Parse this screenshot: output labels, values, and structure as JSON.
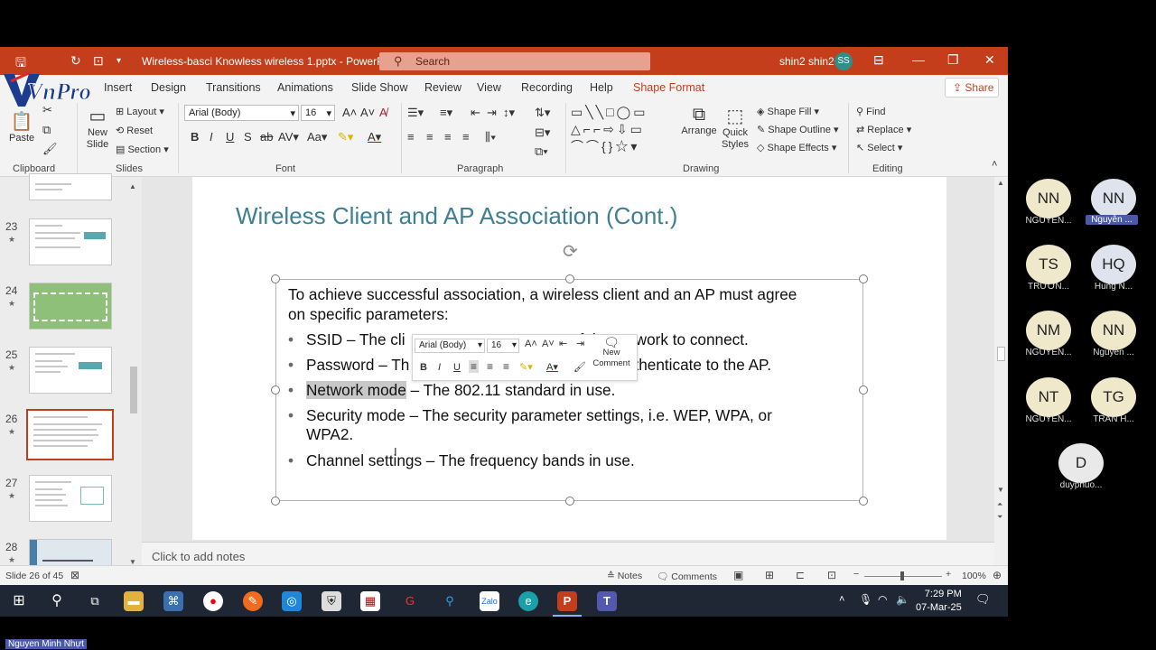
{
  "window": {
    "doc_title": "Wireless-basci Knowless wireless 1.pptx  -  PowerPoint",
    "search_placeholder": "Search",
    "user_name": "shin2 shin2",
    "user_initials": "SS"
  },
  "logo": {
    "text": "VnPro"
  },
  "ribbon_tabs": [
    "Insert",
    "Design",
    "Transitions",
    "Animations",
    "Slide Show",
    "Review",
    "View",
    "Recording",
    "Help",
    "Shape Format"
  ],
  "share_label": "Share",
  "ribbon": {
    "clipboard": {
      "paste": "Paste",
      "group": "Clipboard"
    },
    "slides": {
      "new_slide": "New Slide",
      "layout": "Layout",
      "reset": "Reset",
      "section": "Section",
      "group": "Slides"
    },
    "font": {
      "name": "Arial (Body)",
      "size": "16",
      "group": "Font"
    },
    "paragraph": {
      "group": "Paragraph"
    },
    "drawing": {
      "arrange": "Arrange",
      "quick_styles": "Quick Styles",
      "shape_fill": "Shape Fill",
      "shape_outline": "Shape Outline",
      "shape_effects": "Shape Effects",
      "group": "Drawing"
    },
    "editing": {
      "find": "Find",
      "replace": "Replace",
      "select": "Select",
      "group": "Editing"
    }
  },
  "thumbnails": [
    {
      "num": "23"
    },
    {
      "num": "24"
    },
    {
      "num": "25"
    },
    {
      "num": "26",
      "selected": true
    },
    {
      "num": "27"
    },
    {
      "num": "28"
    }
  ],
  "slide": {
    "title": "Wireless Client and AP Association (Cont.)",
    "intro_line1": "To achieve successful association, a wireless client and an AP must agree",
    "intro_line2": "on specific parameters:",
    "bullets": {
      "b1_start": "SSID – The cli",
      "b1_end": "f the network to connect.",
      "b2_start": "Password – Th",
      "b2_end": "authenticate to the AP.",
      "b3_highlight": "Network mode",
      "b3_rest": " – The 802.11 standard in use.",
      "b4_line1": "Security mode – The security parameter settings, i.e. WEP, WPA, or",
      "b4_line2": "WPA2.",
      "b5": "Channel settings – The frequency bands in use."
    }
  },
  "mini_toolbar": {
    "font": "Arial (Body)",
    "size": "16",
    "new_comment": "New Comment"
  },
  "notes_placeholder": "Click to add notes",
  "status": {
    "slide": "Slide 26 of 45",
    "notes": "Notes",
    "comments": "Comments",
    "zoom": "100%"
  },
  "clock": {
    "time": "7:29 PM",
    "date": "07-Mar-25"
  },
  "participants": [
    {
      "initials": "NN",
      "name": "NGUYEN..."
    },
    {
      "initials": "NN",
      "name": "Nguyễn ..."
    },
    {
      "initials": "TS",
      "name": "TRƯƠN..."
    },
    {
      "initials": "HQ",
      "name": "Hung N..."
    },
    {
      "initials": "NM",
      "name": "NGUYEN..."
    },
    {
      "initials": "NN",
      "name": "Nguyễn ..."
    },
    {
      "initials": "NT",
      "name": "NGUYEN..."
    },
    {
      "initials": "TG",
      "name": "TRAN H..."
    },
    {
      "initials": "D",
      "name": "duyphuo..."
    }
  ],
  "bottom_label": "Nguyen Minh Nhựt",
  "colors": {
    "accent": "#c43e1c",
    "title": "#3d7f94",
    "taskbar": "#1f2735"
  }
}
